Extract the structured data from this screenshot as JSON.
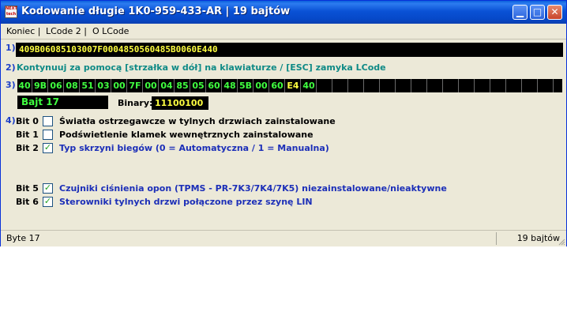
{
  "window": {
    "app_icon_text": "NEXT tech",
    "title": "Kodowanie długie   1K0-959-433-AR | 19 bajtów",
    "minimize_glyph": "▁",
    "maximize_glyph": "□",
    "close_glyph": "✕"
  },
  "menu": [
    {
      "label": "Koniec |"
    },
    {
      "label": "LCode 2 |"
    },
    {
      "label": "O LCode"
    }
  ],
  "section_numbers": [
    "1)",
    "2)",
    "3)",
    "4)"
  ],
  "hex_string": "409B06085103007F0004850560485B0060E440",
  "hint": "Kontynuuj za pomocą [strzałka w dół] na klawiaturze / [ESC] zamyka LCode",
  "bytes": [
    "40",
    "9B",
    "06",
    "08",
    "51",
    "03",
    "00",
    "7F",
    "00",
    "04",
    "85",
    "05",
    "60",
    "48",
    "5B",
    "00",
    "60",
    "E4",
    "40",
    "",
    "",
    "",
    "",
    "",
    "",
    "",
    "",
    "",
    "",
    "",
    "",
    "",
    "",
    "",
    ""
  ],
  "selected_byte_index": 17,
  "byte_label": "Bajt 17",
  "binary_label": "Binary:",
  "binary_value": "11100100",
  "bits": [
    {
      "label": "Bit 0",
      "checked": false,
      "desc": "Światła ostrzegawcze w tylnych drzwiach zainstalowane",
      "row": 0
    },
    {
      "label": "Bit 1",
      "checked": false,
      "desc": "Podświetlenie klamek wewnętrznych zainstalowane",
      "row": 1
    },
    {
      "label": "Bit 2",
      "checked": true,
      "desc": "Typ skrzyni biegów (0 = Automatyczna / 1 = Manualna)",
      "row": 2
    },
    {
      "label": "Bit 5",
      "checked": true,
      "desc": "Czujniki ciśnienia opon (TPMS - PR-7K3/7K4/7K5) niezainstalowane/nieaktywne",
      "row": 5
    },
    {
      "label": "Bit 6",
      "checked": true,
      "desc": "Sterowniki tylnych drzwi połączone przez szynę LIN",
      "row": 6
    }
  ],
  "check_glyph": "✓",
  "status": {
    "left": "Byte 17",
    "right": "19 bajtów"
  },
  "colors": {
    "titlebar": "#0a52d6",
    "panel": "#ece9d8",
    "hex_text": "#ffff40",
    "byte_text": "#40ff40",
    "hint_text": "#0f8a86",
    "active_desc": "#1c2fb8",
    "section_number": "#1c3fc8"
  }
}
